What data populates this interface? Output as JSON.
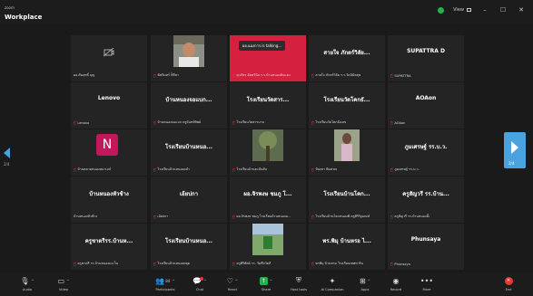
{
  "app": {
    "brand_small": "zoom",
    "brand_name": "Workplace"
  },
  "titlebar": {
    "view_label": "View",
    "colors": {
      "shield": "#22b14c"
    }
  },
  "talking_indicator": "ผอ.แมงการ is talking...",
  "pagination": {
    "left": "2/4",
    "right": "2/4"
  },
  "tiles": [
    {
      "name": "",
      "label": "ผอ.สัมฤทธิ์ บุญ",
      "muted": false,
      "kind": "camera-off"
    },
    {
      "name": "",
      "label": "พัชรินทร์ ก็ทีสา",
      "muted": true,
      "kind": "photo-man"
    },
    {
      "name": "",
      "label": "สุวภัทร อัตตวินิจ ร.ร.บ้านหนองดินแดง",
      "muted": true,
      "kind": "speaking"
    },
    {
      "name": "สายใจ ภักตร์วิลัย...",
      "label": "สายใจ ภักตร์วิลัย ร.ร.วัดนิมิตสุข",
      "muted": true,
      "kind": "name"
    },
    {
      "name": "SUPATTRA D",
      "label": "SUPATTRA",
      "muted": true,
      "kind": "name"
    },
    {
      "name": "Lenovo",
      "label": "Lenovo",
      "muted": true,
      "kind": "name"
    },
    {
      "name": "บ้านหนองจอแบก...",
      "label": "บ้านหนองจอแบก ครูจันทร์ทิพย์",
      "muted": true,
      "kind": "name"
    },
    {
      "name": "โรงเรียนวัดสาร...",
      "label": "โรงเรียนวัดสารบาน",
      "muted": true,
      "kind": "name"
    },
    {
      "name": "โรงเรียนวัดโคกธั...",
      "label": "โรงเรียนวัดโคกธั่งเลข",
      "muted": true,
      "kind": "name"
    },
    {
      "name": "AOAon",
      "label": "AOAon",
      "muted": true,
      "kind": "name"
    },
    {
      "name": "",
      "label": "บ้านตลาดหนองหมาเจน์",
      "muted": true,
      "kind": "avatar-n",
      "initial": "N"
    },
    {
      "name": "โรงเรียนบ้านหนอ...",
      "label": "โรงเรียนบ้านหนองคลำ",
      "muted": true,
      "kind": "name"
    },
    {
      "name": "",
      "label": "โรงเรียนบ้านตะลันสัน",
      "muted": true,
      "kind": "photo-tree"
    },
    {
      "name": "",
      "label": "ปัณฑา พิมสรณ",
      "muted": true,
      "kind": "photo-woman"
    },
    {
      "name": "ภูมเศรษฐ์ รร.บ.ว.",
      "label": "ภูมเศรษฐ์ รร.บ.ว.",
      "muted": true,
      "kind": "name"
    },
    {
      "name": "บ้านหนองหัวช้าง",
      "label": "บ้านหนองหัวช้าง",
      "muted": false,
      "kind": "name"
    },
    {
      "name": "เอ้ยปกา",
      "label": "เอ้ยปกา",
      "muted": true,
      "kind": "name"
    },
    {
      "name": "ผอ.จิรพงษ ชมภู โ...",
      "label": "ผอ.จิรพงษ ชมภู โรงเรียนบ้านหนองม...",
      "muted": true,
      "kind": "name"
    },
    {
      "name": "โรงเรียนบ้านโคก...",
      "label": "โรงเรียนบ้านโคกหนองพิ ครูศิริรัฐมณฑ์",
      "muted": true,
      "kind": "name"
    },
    {
      "name": "ครูสัญวรี รร.บ้าน...",
      "label": "ครูสัญวรี รร.บ้านหนองยั้ง",
      "muted": true,
      "kind": "name"
    },
    {
      "name": "ครูชาตรีรร.บ้านห...",
      "label": "ครูชาตรี รร.บ้านหนองมะเว็น",
      "muted": true,
      "kind": "name"
    },
    {
      "name": "โรงเรียนบ้านหนอ...",
      "label": "โรงเรียนบ้านหนองพลุด",
      "muted": true,
      "kind": "name"
    },
    {
      "name": "",
      "label": "ครูศิริพัสย์ รร. วัดตึกวัดดี",
      "muted": true,
      "kind": "photo-field"
    },
    {
      "name": "พร.พิมุ บ้านหรอ ไ...",
      "label": "พรพิมุ บ้านหรอ โรงเรียนเทพทาริน",
      "muted": true,
      "kind": "name"
    },
    {
      "name": "Phunsaya",
      "label": "Phunsaya",
      "muted": true,
      "kind": "name"
    }
  ],
  "toolbar": {
    "audio": "Audio",
    "video": "Video",
    "participants": "Participants",
    "participants_count": "84",
    "chat": "Chat",
    "react": "React",
    "share": "Share",
    "host_tools": "Host tools",
    "ai_companion": "AI Companion",
    "apps": "Apps",
    "record": "Record",
    "more": "More",
    "end": "End"
  }
}
